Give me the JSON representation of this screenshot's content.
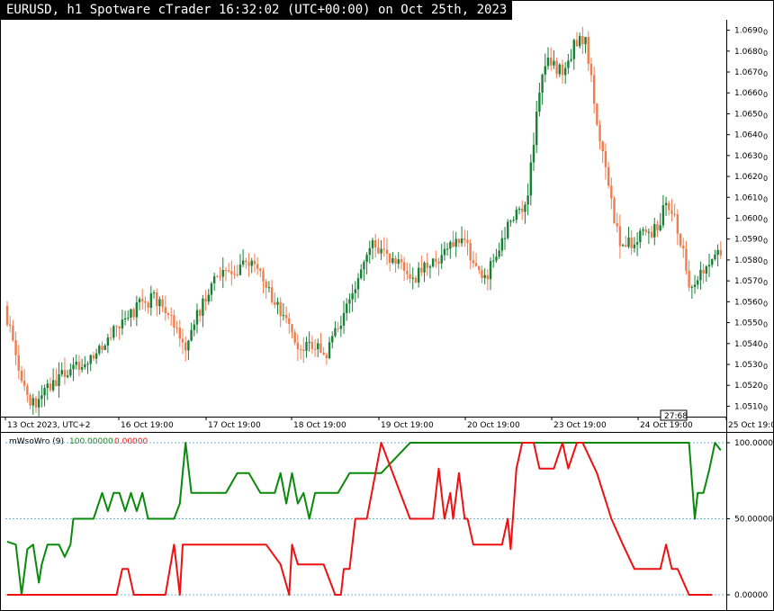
{
  "header": {
    "title": "EURUSD, h1 Spotware cTrader 16:32:02 (UTC+00:00) on Oct 25th, 2023"
  },
  "colors": {
    "bull": "#1a7f37",
    "bear": "#f07c4e",
    "indicator_green": "#0a8a0a",
    "indicator_red": "#ee1111",
    "level_line": "#6fb7d9"
  },
  "chart_data": [
    {
      "type": "candlestick",
      "symbol": "EURUSD",
      "timeframe": "h1",
      "ylim": [
        1.0505,
        1.0695
      ],
      "y_ticks": [
        {
          "value": 1.069,
          "label": "1.0690",
          "sub": "0"
        },
        {
          "value": 1.068,
          "label": "1.0680",
          "sub": "0"
        },
        {
          "value": 1.067,
          "label": "1.0670",
          "sub": "0"
        },
        {
          "value": 1.066,
          "label": "1.0660",
          "sub": "0"
        },
        {
          "value": 1.065,
          "label": "1.0650",
          "sub": "0"
        },
        {
          "value": 1.064,
          "label": "1.0640",
          "sub": "0"
        },
        {
          "value": 1.063,
          "label": "1.0630",
          "sub": "0"
        },
        {
          "value": 1.062,
          "label": "1.0620",
          "sub": "0"
        },
        {
          "value": 1.061,
          "label": "1.0610",
          "sub": "0"
        },
        {
          "value": 1.06,
          "label": "1.0600",
          "sub": "0"
        },
        {
          "value": 1.059,
          "label": "1.0590",
          "sub": "0"
        },
        {
          "value": 1.058,
          "label": "1.0580",
          "sub": "0"
        },
        {
          "value": 1.057,
          "label": "1.0570",
          "sub": "0"
        },
        {
          "value": 1.056,
          "label": "1.0560",
          "sub": "0"
        },
        {
          "value": 1.055,
          "label": "1.0550",
          "sub": "0"
        },
        {
          "value": 1.054,
          "label": "1.0540",
          "sub": "0"
        },
        {
          "value": 1.053,
          "label": "1.0530",
          "sub": "0"
        },
        {
          "value": 1.052,
          "label": "1.0520",
          "sub": "0"
        },
        {
          "value": 1.051,
          "label": "1.0510",
          "sub": "0"
        }
      ],
      "x_labels": [
        "13 Oct 2023, UTC+2",
        "16 Oct 19:00",
        "17 Oct 19:00",
        "18 Oct 19:00",
        "19 Oct 19:00",
        "20 Oct 19:00",
        "23 Oct 19:00",
        "24 Oct 19:00",
        "25 Oct 19:00"
      ],
      "cursor_label": "27:68",
      "price_path": [
        [
          0,
          1.0558
        ],
        [
          5,
          1.0527
        ],
        [
          9,
          1.0509
        ],
        [
          14,
          1.0518
        ],
        [
          20,
          1.0524
        ],
        [
          27,
          1.053
        ],
        [
          33,
          1.0538
        ],
        [
          40,
          1.0548
        ],
        [
          46,
          1.0557
        ],
        [
          52,
          1.0562
        ],
        [
          56,
          1.0555
        ],
        [
          60,
          1.0546
        ],
        [
          63,
          1.0538
        ],
        [
          67,
          1.0553
        ],
        [
          72,
          1.0568
        ],
        [
          77,
          1.0577
        ],
        [
          80,
          1.0571
        ],
        [
          85,
          1.058
        ],
        [
          89,
          1.0573
        ],
        [
          94,
          1.056
        ],
        [
          98,
          1.0552
        ],
        [
          102,
          1.054
        ],
        [
          105,
          1.0538
        ],
        [
          109,
          1.0537
        ],
        [
          112,
          1.0535
        ],
        [
          115,
          1.0544
        ],
        [
          119,
          1.0556
        ],
        [
          123,
          1.0568
        ],
        [
          126,
          1.058
        ],
        [
          128,
          1.0589
        ],
        [
          130,
          1.0583
        ],
        [
          133,
          1.0584
        ],
        [
          136,
          1.0578
        ],
        [
          139,
          1.0575
        ],
        [
          142,
          1.0572
        ],
        [
          145,
          1.0574
        ],
        [
          148,
          1.0578
        ],
        [
          152,
          1.0582
        ],
        [
          154,
          1.0584
        ],
        [
          156,
          1.0588
        ],
        [
          159,
          1.0589
        ],
        [
          161,
          1.0585
        ],
        [
          163,
          1.0579
        ],
        [
          165,
          1.0574
        ],
        [
          168,
          1.0574
        ],
        [
          170,
          1.0579
        ],
        [
          173,
          1.0588
        ],
        [
          176,
          1.0599
        ],
        [
          178,
          1.0605
        ],
        [
          180,
          1.0603
        ],
        [
          182,
          1.0612
        ],
        [
          183,
          1.0628
        ],
        [
          185,
          1.0648
        ],
        [
          187,
          1.0668
        ],
        [
          189,
          1.0676
        ],
        [
          192,
          1.067
        ],
        [
          194,
          1.0672
        ],
        [
          196,
          1.0677
        ],
        [
          198,
          1.0682
        ],
        [
          200,
          1.0686
        ],
        [
          202,
          1.0684
        ],
        [
          204,
          1.0666
        ],
        [
          206,
          1.0648
        ],
        [
          208,
          1.063
        ],
        [
          210,
          1.0613
        ],
        [
          212,
          1.06
        ],
        [
          214,
          1.059
        ],
        [
          217,
          1.0588
        ],
        [
          220,
          1.059
        ],
        [
          223,
          1.0592
        ],
        [
          226,
          1.0594
        ],
        [
          229,
          1.0603
        ],
        [
          231,
          1.0605
        ],
        [
          233,
          1.06
        ],
        [
          235,
          1.059
        ],
        [
          237,
          1.0578
        ],
        [
          238,
          1.057
        ],
        [
          240,
          1.0571
        ],
        [
          242,
          1.0574
        ],
        [
          245,
          1.058
        ],
        [
          247,
          1.0584
        ]
      ]
    },
    {
      "type": "line",
      "title": "mWsoWro (9)",
      "value_labels": [
        "100.00000",
        "0.00000"
      ],
      "ylim": [
        0,
        100
      ],
      "y_ticks": [
        {
          "value": 100,
          "label": "100.00000"
        },
        {
          "value": 50,
          "label": "50.00000"
        },
        {
          "value": 0,
          "label": "0.00000"
        }
      ],
      "levels": [
        100,
        50,
        0
      ],
      "series": [
        {
          "color": "green",
          "x": [
            0,
            3,
            5,
            7,
            9,
            11,
            12,
            14,
            16,
            18,
            20,
            22,
            23,
            26,
            28,
            30,
            33,
            35,
            37,
            39,
            41,
            43,
            45,
            47,
            49,
            55,
            58,
            60,
            62,
            64,
            66,
            68,
            70,
            72,
            74,
            76,
            80,
            84,
            88,
            93,
            95,
            97,
            99,
            101,
            103,
            105,
            107,
            110,
            115,
            119,
            125,
            130,
            140,
            150,
            160,
            170,
            180,
            190,
            200,
            210,
            220,
            224,
            226,
            228,
            230,
            231,
            233,
            235,
            237,
            239,
            240,
            242,
            244,
            246,
            248
          ],
          "y": [
            35,
            33,
            0,
            30,
            33,
            8,
            20,
            33,
            33,
            33,
            25,
            33,
            50,
            50,
            50,
            50,
            67,
            55,
            67,
            67,
            55,
            67,
            55,
            67,
            50,
            50,
            50,
            60,
            100,
            67,
            67,
            67,
            67,
            67,
            67,
            67,
            80,
            80,
            67,
            67,
            80,
            60,
            80,
            60,
            67,
            50,
            67,
            67,
            67,
            80,
            80,
            80,
            100,
            100,
            100,
            100,
            100,
            100,
            100,
            100,
            100,
            100,
            100,
            100,
            100,
            100,
            100,
            100,
            100,
            50,
            67,
            67,
            82,
            100,
            95
          ]
        },
        {
          "color": "red",
          "x": [
            0,
            25,
            30,
            38,
            40,
            42,
            44,
            50,
            55,
            58,
            60,
            61,
            63,
            65,
            70,
            80,
            85,
            90,
            95,
            98,
            99,
            101,
            110,
            114,
            116,
            117,
            119,
            121,
            123,
            125,
            130,
            140,
            148,
            150,
            152,
            154,
            155,
            157,
            159,
            160,
            162,
            164,
            170,
            172,
            174,
            175,
            177,
            179,
            183,
            185,
            190,
            193,
            195,
            198,
            200,
            205,
            210,
            214,
            218,
            220,
            222,
            225,
            227,
            229,
            231,
            233,
            237,
            245
          ],
          "y": [
            0,
            0,
            0,
            0,
            17,
            17,
            0,
            0,
            0,
            33,
            0,
            33,
            33,
            33,
            33,
            33,
            33,
            33,
            20,
            0,
            33,
            20,
            20,
            0,
            0,
            17,
            17,
            50,
            50,
            50,
            100,
            50,
            50,
            83,
            50,
            67,
            50,
            80,
            50,
            50,
            33,
            33,
            33,
            33,
            50,
            30,
            83,
            100,
            100,
            83,
            83,
            100,
            83,
            100,
            100,
            80,
            50,
            33,
            17,
            17,
            17,
            17,
            17,
            33,
            17,
            17,
            0,
            0
          ]
        }
      ]
    }
  ]
}
